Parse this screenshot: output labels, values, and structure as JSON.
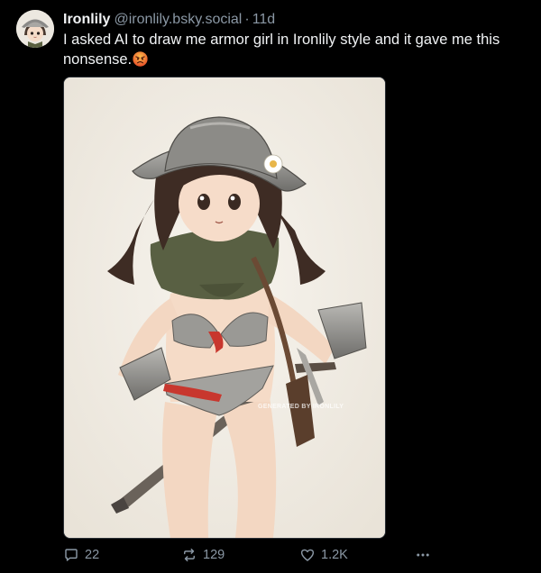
{
  "author": {
    "display_name": "Ironlily",
    "handle": "@ironlily.bsky.social",
    "separator": "·",
    "timestamp": "11d",
    "avatar_icon": "avatar-girl-helmet-icon"
  },
  "post": {
    "text": "I asked AI to draw me armor girl in Ironlily style and it gave me this nonsense.",
    "emoji_icon": "angry-face-icon"
  },
  "media": {
    "description_icon": "armored-girl-illustration",
    "watermark": "GENERATED BY IRONLILY"
  },
  "actions": {
    "replies": "22",
    "reposts": "129",
    "likes": "1.2K",
    "more_icon": "ellipsis-icon"
  },
  "colors": {
    "background": "#000000",
    "text": "#f1f3f5",
    "muted": "#8b98a5",
    "image_bg": "#f2eee6"
  }
}
